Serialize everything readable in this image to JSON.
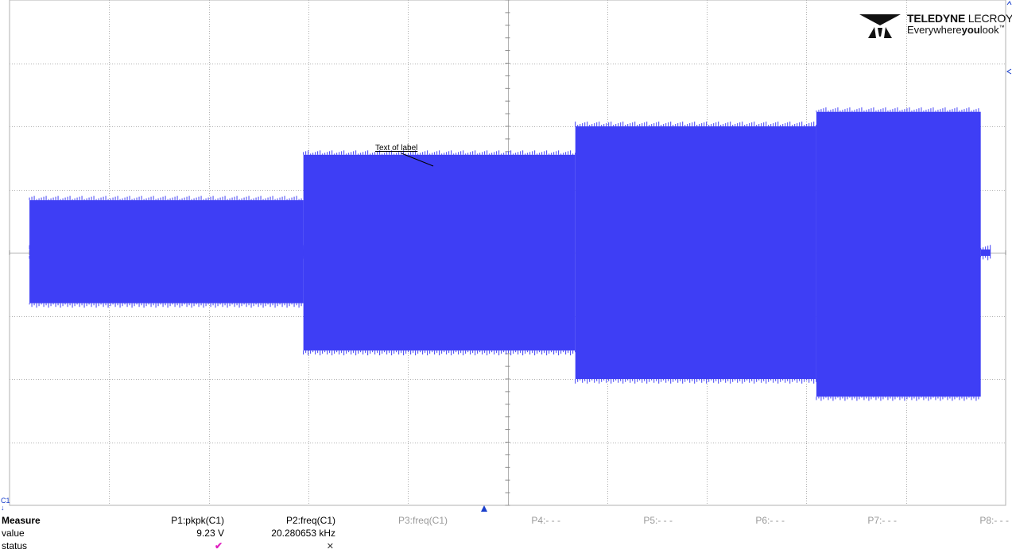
{
  "logo": {
    "brand_bold": "TELEDYNE",
    "brand_rest": " LECROY",
    "tagline_a": "Everywhere",
    "tagline_b": "you",
    "tagline_c": "look",
    "tm": "™"
  },
  "annotation": {
    "label": "Text of label"
  },
  "channel_tag": "C1",
  "measure": {
    "heading": "Measure",
    "row_value": "value",
    "row_status": "status",
    "params": [
      {
        "name": "P1:pkpk(C1)",
        "value": "9.23 V",
        "status": "check",
        "active": true
      },
      {
        "name": "P2:freq(C1)",
        "value": "20.280653 kHz",
        "status": "x",
        "active": true
      },
      {
        "name": "P3:freq(C1)",
        "value": "",
        "status": "",
        "active": false
      },
      {
        "name": "P4:- - -",
        "value": "",
        "status": "",
        "active": false
      },
      {
        "name": "P5:- - -",
        "value": "",
        "status": "",
        "active": false
      },
      {
        "name": "P6:- - -",
        "value": "",
        "status": "",
        "active": false
      },
      {
        "name": "P7:- - -",
        "value": "",
        "status": "",
        "active": false
      },
      {
        "name": "P8:- - -",
        "value": "",
        "status": "",
        "active": false
      }
    ]
  },
  "colors": {
    "trace": "#3e3ef5",
    "grid": "#b0b0b0",
    "marker": "#1a3fcc"
  },
  "chart_data": {
    "type": "area",
    "grid": true,
    "divisions": {
      "x": 10,
      "y": 8
    },
    "segments": [
      {
        "t": [
          0.2,
          3.0
        ],
        "high": 0.0,
        "low": 0.0
      },
      {
        "t": [
          0.2,
          2.95
        ],
        "high": 0.83,
        "low": -0.8
      },
      {
        "t": [
          2.95,
          5.68
        ],
        "high": 1.55,
        "low": -1.55
      },
      {
        "t": [
          5.68,
          8.1
        ],
        "high": 2.0,
        "low": -2.0
      },
      {
        "t": [
          8.1,
          9.75
        ],
        "high": 2.23,
        "low": -2.28
      },
      {
        "t": [
          9.75,
          9.85
        ],
        "high": 0.0,
        "low": 0.0
      }
    ]
  }
}
